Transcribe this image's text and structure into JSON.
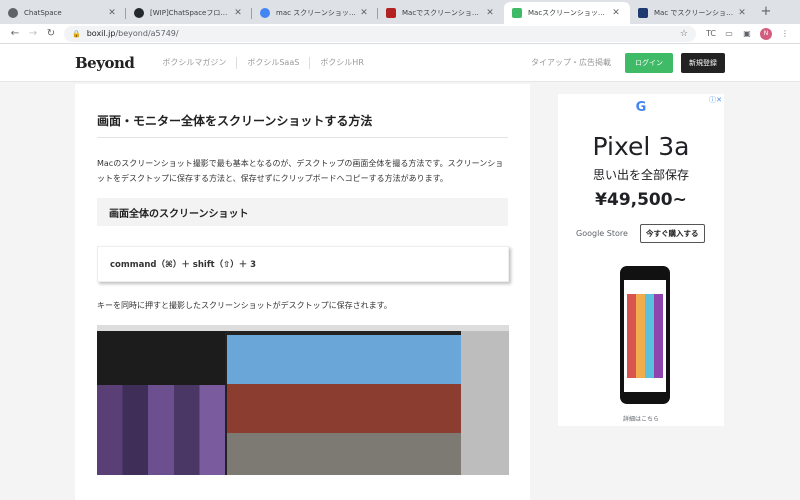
{
  "browser": {
    "tabs": [
      {
        "title": "ChatSpace",
        "favicon_color": "#5f6368",
        "active": false
      },
      {
        "title": "[WIP]ChatSpaceフロント実装",
        "favicon_color": "#24292e",
        "active": false
      },
      {
        "title": "mac スクリーンショット - Goo",
        "favicon_color": "#4285f4",
        "active": false
      },
      {
        "title": "Macでスクリーンショットを撮",
        "favicon_color": "#b22222",
        "active": false
      },
      {
        "title": "Macスクリーンショット方法 |",
        "favicon_color": "#3fba67",
        "active": true
      },
      {
        "title": "Mac でスクリーンショットを撮",
        "favicon_color": "#1e3a6e",
        "active": false
      }
    ],
    "url_domain": "boxil.jp",
    "url_path": "/beyond/a5749/",
    "avatar_letter": "N"
  },
  "site": {
    "logo": "Beyond",
    "nav": [
      "ボクシルマガジン",
      "ボクシルSaaS",
      "ボクシルHR"
    ],
    "tieup": "タイアップ・広告掲載",
    "login": "ログイン",
    "signup": "新規登録"
  },
  "article": {
    "heading": "画面・モニター全体をスクリーンショットする方法",
    "paragraph": "Macのスクリーンショット撮影で最も基本となるのが、デスクトップの画面全体を撮る方法です。スクリーンショットをデスクトップに保存する方法と、保存せずにクリップボードへコピーする方法があります。",
    "subheading": "画面全体のスクリーンショット",
    "command": "command（⌘）＋ shift（⇧）＋ 3",
    "caption": "キーを同時に押すと撮影したスクリーンショットがデスクトップに保存されます。"
  },
  "ad": {
    "brand_icon": "google-g-icon",
    "product": "Pixel 3a",
    "tagline": "思い出を全部保存",
    "price": "¥49,500~",
    "store": "Google Store",
    "cta": "今すぐ購入する",
    "details": "詳細はこちら"
  }
}
